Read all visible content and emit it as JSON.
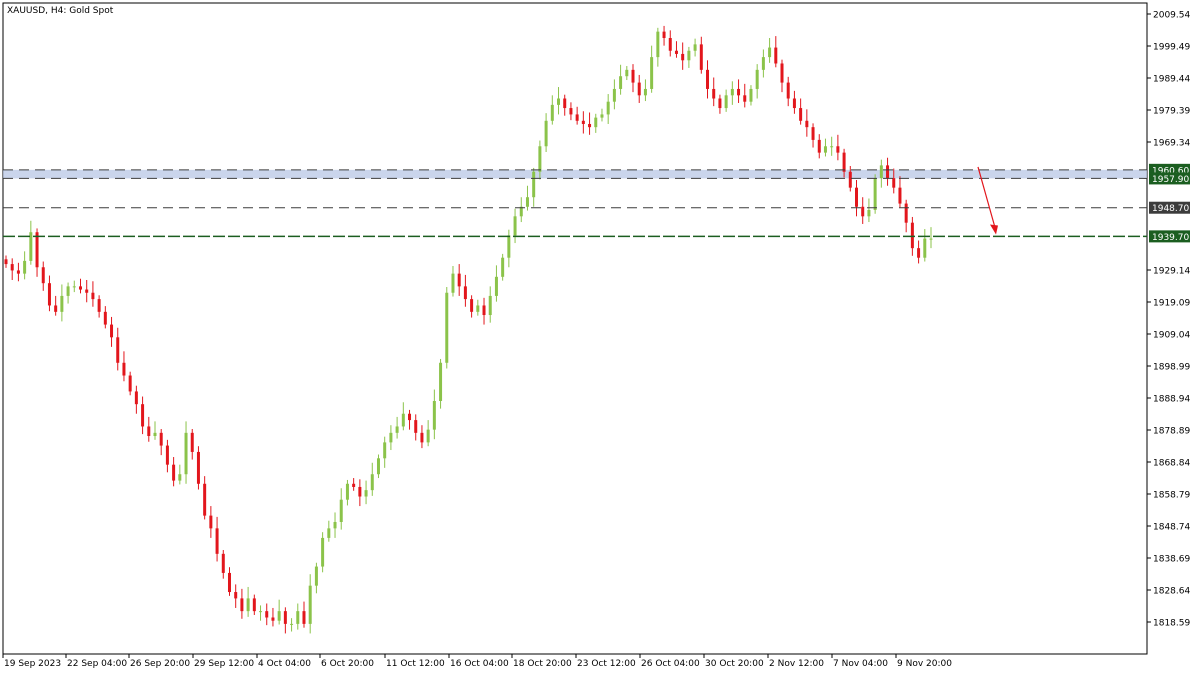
{
  "header": {
    "title": "XAUUSD, H4:  Gold Spot"
  },
  "colors": {
    "bull": "#8bc34a",
    "bear": "#e2161c",
    "level_dark": "#1b5e20",
    "level_gray": "#3c3c3c",
    "band_fill": "#b8c7e6",
    "arrow": "#e2161c"
  },
  "chart_data": {
    "type": "candlestick",
    "title": "XAUUSD, H4:  Gold Spot",
    "y_ticks": [
      "2009.54",
      "1999.49",
      "1989.44",
      "1979.39",
      "1969.34",
      "1929.14",
      "1919.09",
      "1909.04",
      "1898.99",
      "1888.94",
      "1878.89",
      "1868.84",
      "1858.79",
      "1848.74",
      "1838.69",
      "1828.64",
      "1818.59"
    ],
    "x_ticks": [
      "19 Sep 2023",
      "22 Sep 04:00",
      "26 Sep 20:00",
      "29 Sep 12:00",
      "4 Oct 04:00",
      "6 Oct 20:00",
      "11 Oct 12:00",
      "16 Oct 04:00",
      "18 Oct 20:00",
      "23 Oct 12:00",
      "26 Oct 04:00",
      "30 Oct 20:00",
      "2 Nov 12:00",
      "7 Nov 04:00",
      "9 Nov 20:00"
    ],
    "ylim": [
      1813,
      2012
    ],
    "levels": [
      {
        "value": 1960.6,
        "label": "1960.60",
        "style": "band-top"
      },
      {
        "value": 1957.9,
        "label": "1957.90",
        "style": "band-bottom"
      },
      {
        "value": 1948.7,
        "label": "1948.70",
        "style": "dashed-gray"
      },
      {
        "value": 1939.7,
        "label": "1939.70",
        "style": "solid-green"
      }
    ],
    "close_path": [
      1931,
      1929,
      1928,
      1932,
      1941,
      1930,
      1925,
      1918,
      1916,
      1921,
      1924,
      1924,
      1923,
      1922,
      1920,
      1916,
      1912,
      1908,
      1900,
      1896,
      1891,
      1887,
      1880,
      1877,
      1878,
      1874,
      1868,
      1863,
      1865,
      1878,
      1872,
      1862,
      1852,
      1848,
      1840,
      1834,
      1828,
      1826,
      1822,
      1826,
      1822,
      1822,
      1820,
      1819,
      1822,
      1818,
      1818,
      1822,
      1818,
      1830,
      1836,
      1845,
      1848,
      1850,
      1857,
      1862,
      1861,
      1858,
      1860,
      1865,
      1870,
      1875,
      1878,
      1880,
      1884,
      1882,
      1878,
      1875,
      1879,
      1888,
      1900,
      1922,
      1928,
      1924,
      1920,
      1916,
      1918,
      1915,
      1921,
      1927,
      1933,
      1940,
      1946,
      1949,
      1952,
      1960,
      1968,
      1976,
      1981,
      1983,
      1980,
      1978,
      1976,
      1975,
      1974,
      1977,
      1978,
      1982,
      1986,
      1990,
      1992,
      1988,
      1984,
      1986,
      1996,
      2004,
      2002,
      1998,
      1997,
      1995,
      1998,
      2000,
      1992,
      1986,
      1983,
      1980,
      1984,
      1986,
      1984,
      1982,
      1986,
      1992,
      1996,
      1999,
      1994,
      1988,
      1983,
      1980,
      1976,
      1974,
      1970,
      1966,
      1968,
      1968,
      1966,
      1960,
      1955,
      1949,
      1946,
      1948,
      1958,
      1962,
      1958,
      1955,
      1950,
      1944,
      1936,
      1933,
      1939,
      1939
    ],
    "arrow": {
      "from": [
        1958,
        1961
      ],
      "to": [
        1996,
        1939
      ],
      "direction": "down"
    }
  }
}
